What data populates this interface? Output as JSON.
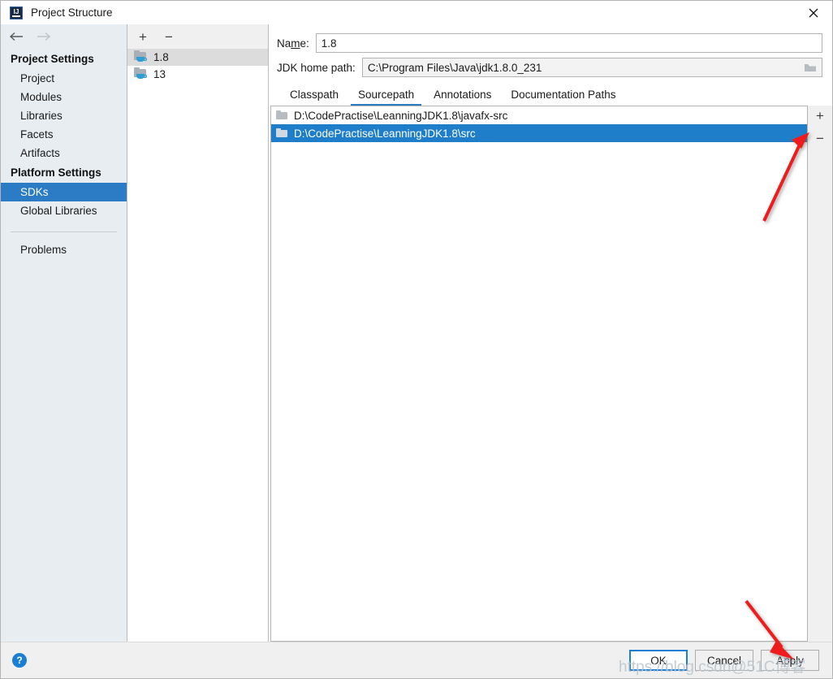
{
  "window": {
    "title": "Project Structure",
    "app_icon": "intellij-idea-icon",
    "close_icon": "close-icon"
  },
  "nav": {
    "back_icon": "arrow-left-icon",
    "forward_icon": "arrow-right-icon"
  },
  "sidebar": {
    "groups": [
      {
        "label": "Project Settings",
        "items": [
          {
            "label": "Project",
            "selected": false
          },
          {
            "label": "Modules",
            "selected": false
          },
          {
            "label": "Libraries",
            "selected": false
          },
          {
            "label": "Facets",
            "selected": false
          },
          {
            "label": "Artifacts",
            "selected": false
          }
        ]
      },
      {
        "label": "Platform Settings",
        "items": [
          {
            "label": "SDKs",
            "selected": true
          },
          {
            "label": "Global Libraries",
            "selected": false
          }
        ]
      }
    ],
    "extra": [
      {
        "label": "Problems",
        "selected": false
      }
    ]
  },
  "sdk_list": {
    "toolbar": {
      "add_label": "+",
      "add_icon": "plus-icon",
      "remove_label": "−",
      "remove_icon": "minus-icon"
    },
    "items": [
      {
        "label": "1.8",
        "icon": "jdk-folder-icon",
        "selected": true
      },
      {
        "label": "13",
        "icon": "jdk-folder-icon",
        "selected": false
      }
    ]
  },
  "detail": {
    "name_label_pre": "Na",
    "name_label_mnemonic": "m",
    "name_label_post": "e:",
    "name_value": "1.8",
    "name_placeholder": "",
    "home_label": "JDK home path:",
    "home_value": "C:\\Program Files\\Java\\jdk1.8.0_231",
    "home_placeholder": "",
    "browse_icon": "folder-browse-icon",
    "tabs": [
      {
        "label": "Classpath",
        "active": false
      },
      {
        "label": "Sourcepath",
        "active": true
      },
      {
        "label": "Annotations",
        "active": false
      },
      {
        "label": "Documentation Paths",
        "active": false
      }
    ],
    "paths": [
      {
        "label": "D:\\CodePractise\\LeanningJDK1.8\\javafx-src",
        "icon": "folder-icon",
        "selected": false
      },
      {
        "label": "D:\\CodePractise\\LeanningJDK1.8\\src",
        "icon": "folder-icon",
        "selected": true
      }
    ],
    "list_buttons": {
      "add_label": "+",
      "add_icon": "plus-icon",
      "remove_label": "−",
      "remove_icon": "minus-icon"
    }
  },
  "footer": {
    "help_label": "?",
    "help_icon": "help-icon",
    "ok_label": "OK",
    "cancel_label": "Cancel",
    "apply_label": "Apply"
  },
  "annotations": {
    "arrow_color": "#ee1c1c",
    "arrow_1_name": "arrow-pointing-to-selected-path",
    "arrow_2_name": "arrow-pointing-to-apply-button"
  },
  "watermark": {
    "text": "https://blog.csdn@51C博客"
  },
  "colors": {
    "selection_blue": "#1f7ec9",
    "sidebar_selection": "#2b7cc4",
    "accent": "#1a7fd4",
    "sidebar_bg": "#e8edf1",
    "panel_bg": "#f0f0f0"
  }
}
